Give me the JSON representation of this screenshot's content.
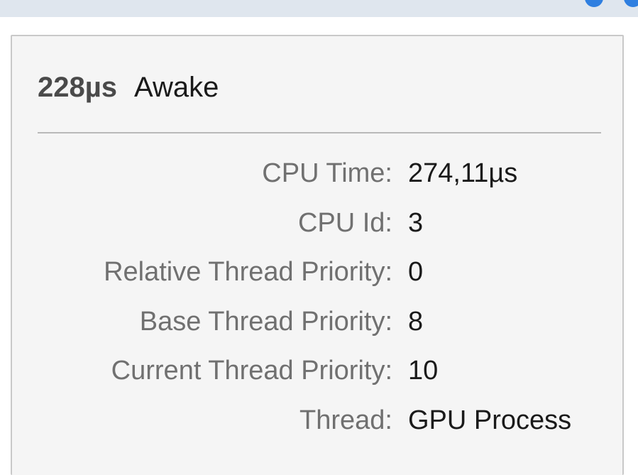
{
  "tooltip": {
    "duration": "228µs",
    "state": "Awake",
    "rows": [
      {
        "label": "CPU Time:",
        "value": "274,11µs"
      },
      {
        "label": "CPU Id:",
        "value": "3"
      },
      {
        "label": "Relative Thread Priority:",
        "value": "0"
      },
      {
        "label": "Base Thread Priority:",
        "value": "8"
      },
      {
        "label": "Current Thread Priority:",
        "value": "10"
      },
      {
        "label": "Thread:",
        "value": "GPU Process"
      }
    ]
  },
  "colors": {
    "background": "#f5f5f5",
    "border": "#c9c9c9",
    "label": "#707070",
    "value": "#1a1a1a",
    "accent": "#2f7fe0"
  }
}
